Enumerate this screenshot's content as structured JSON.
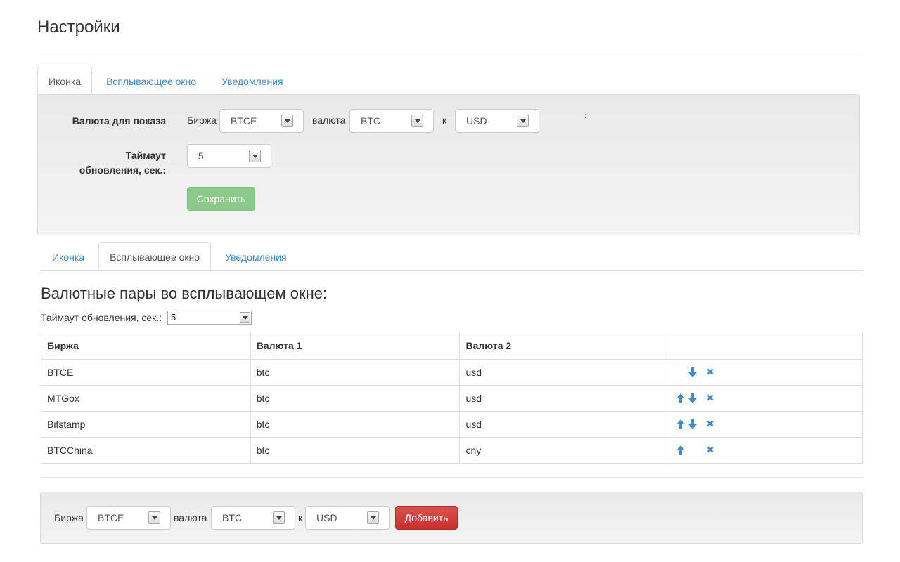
{
  "page": {
    "title": "Настройки"
  },
  "tabs_top": [
    {
      "label": "Иконка",
      "active": true
    },
    {
      "label": "Всплывающее окно",
      "active": false
    },
    {
      "label": "Уведомления",
      "active": false
    }
  ],
  "icon_panel": {
    "currency_label": "Валюта для показа",
    "exchange_label": "Биржа",
    "exchange_value": "BTCE",
    "currency_word": "валюта",
    "currency_value": "BTC",
    "to_word": "к",
    "to_value": "USD",
    "stray_char": ":",
    "timeout_label_line1": "Таймаут",
    "timeout_label_line2": "обновления, сек.:",
    "timeout_value": "5",
    "save_label": "Сохранить"
  },
  "tabs_popup": [
    {
      "label": "Иконка",
      "active": false
    },
    {
      "label": "Всплывающее окно",
      "active": true
    },
    {
      "label": "Уведомления",
      "active": false
    }
  ],
  "popup": {
    "heading": "Валютные пары во всплывающем окне:",
    "timeout_label": "Таймаут обновления, сек.:",
    "timeout_value": "5",
    "columns": [
      "Биржа",
      "Валюта 1",
      "Валюта 2",
      ""
    ],
    "rows": [
      {
        "exchange": "BTCE",
        "currency1": "btc",
        "currency2": "usd",
        "up": false,
        "down": true,
        "remove": true
      },
      {
        "exchange": "MTGox",
        "currency1": "btc",
        "currency2": "usd",
        "up": true,
        "down": true,
        "remove": true
      },
      {
        "exchange": "Bitstamp",
        "currency1": "btc",
        "currency2": "usd",
        "up": true,
        "down": true,
        "remove": true
      },
      {
        "exchange": "BTCChina",
        "currency1": "btc",
        "currency2": "cny",
        "up": true,
        "down": false,
        "remove": true
      }
    ]
  },
  "add_panel": {
    "exchange_label": "Биржа",
    "exchange_value": "BTCE",
    "currency_word": "валюта",
    "currency_value": "BTC",
    "to_word": "к",
    "to_value": "USD",
    "add_label": "Добавить"
  },
  "icons": {
    "up": "arrow-up-icon",
    "down": "arrow-down-icon",
    "remove": "remove-icon"
  },
  "colors": {
    "link": "#428bca",
    "save_button": "#86c786",
    "add_button": "#d9534f",
    "action_icon": "#428bca"
  }
}
